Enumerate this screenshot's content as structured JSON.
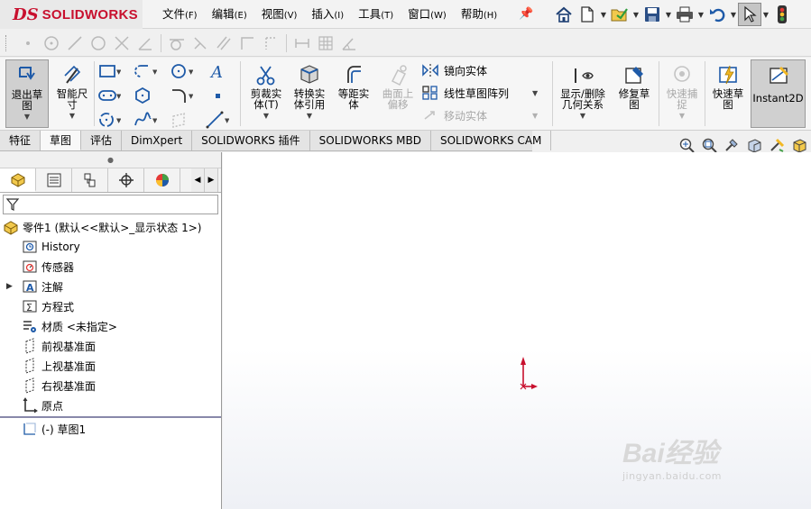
{
  "app": {
    "logo_prefix": "DS",
    "logo_name": "SOLIDWORKS"
  },
  "menu": [
    {
      "label": "文件",
      "accel": "(F)"
    },
    {
      "label": "编辑",
      "accel": "(E)"
    },
    {
      "label": "视图",
      "accel": "(V)"
    },
    {
      "label": "插入",
      "accel": "(I)"
    },
    {
      "label": "工具",
      "accel": "(T)"
    },
    {
      "label": "窗口",
      "accel": "(W)"
    },
    {
      "label": "帮助",
      "accel": "(H)"
    }
  ],
  "commands": {
    "exit_sketch": "退出草\n图",
    "smart_dimension": "智能尺\n寸",
    "trim": "剪裁实\n体(T)",
    "convert": "转换实\n体引用",
    "offset": "等距实\n体",
    "surface_offset": "曲面上\n偏移",
    "mirror": "镜向实体",
    "linear_pattern": "线性草图阵列",
    "move": "移动实体",
    "display_relations": "显示/删除\n几何关系",
    "repair": "修复草\n图",
    "quick_snaps": "快速捕\n捉",
    "rapid_sketch": "快速草\n图",
    "instant2d": "Instant2D"
  },
  "tabs": [
    {
      "label": "特征",
      "active": false
    },
    {
      "label": "草图",
      "active": true
    },
    {
      "label": "评估",
      "active": false
    },
    {
      "label": "DimXpert",
      "active": false
    },
    {
      "label": "SOLIDWORKS 插件",
      "active": false
    },
    {
      "label": "SOLIDWORKS MBD",
      "active": false
    },
    {
      "label": "SOLIDWORKS CAM",
      "active": false
    }
  ],
  "tree": {
    "root": "零件1  (默认<<默认>_显示状态 1>)",
    "items": [
      {
        "label": "History",
        "icon": "history-icon"
      },
      {
        "label": "传感器",
        "icon": "sensor-icon"
      },
      {
        "label": "注解",
        "icon": "annotation-icon"
      },
      {
        "label": "方程式",
        "icon": "equation-icon"
      },
      {
        "label": "材质 <未指定>",
        "icon": "material-icon"
      },
      {
        "label": "前视基准面",
        "icon": "plane-icon"
      },
      {
        "label": "上视基准面",
        "icon": "plane-icon"
      },
      {
        "label": "右视基准面",
        "icon": "plane-icon"
      },
      {
        "label": "原点",
        "icon": "origin-icon"
      }
    ],
    "sketch": "(-) 草图1"
  },
  "watermark": {
    "main": "Bai经验",
    "sub": "jingyan.baidu.com"
  },
  "colors": {
    "brand": "#c8102e",
    "origin": "#c8102e",
    "accent_blue": "#1e5aa8"
  }
}
